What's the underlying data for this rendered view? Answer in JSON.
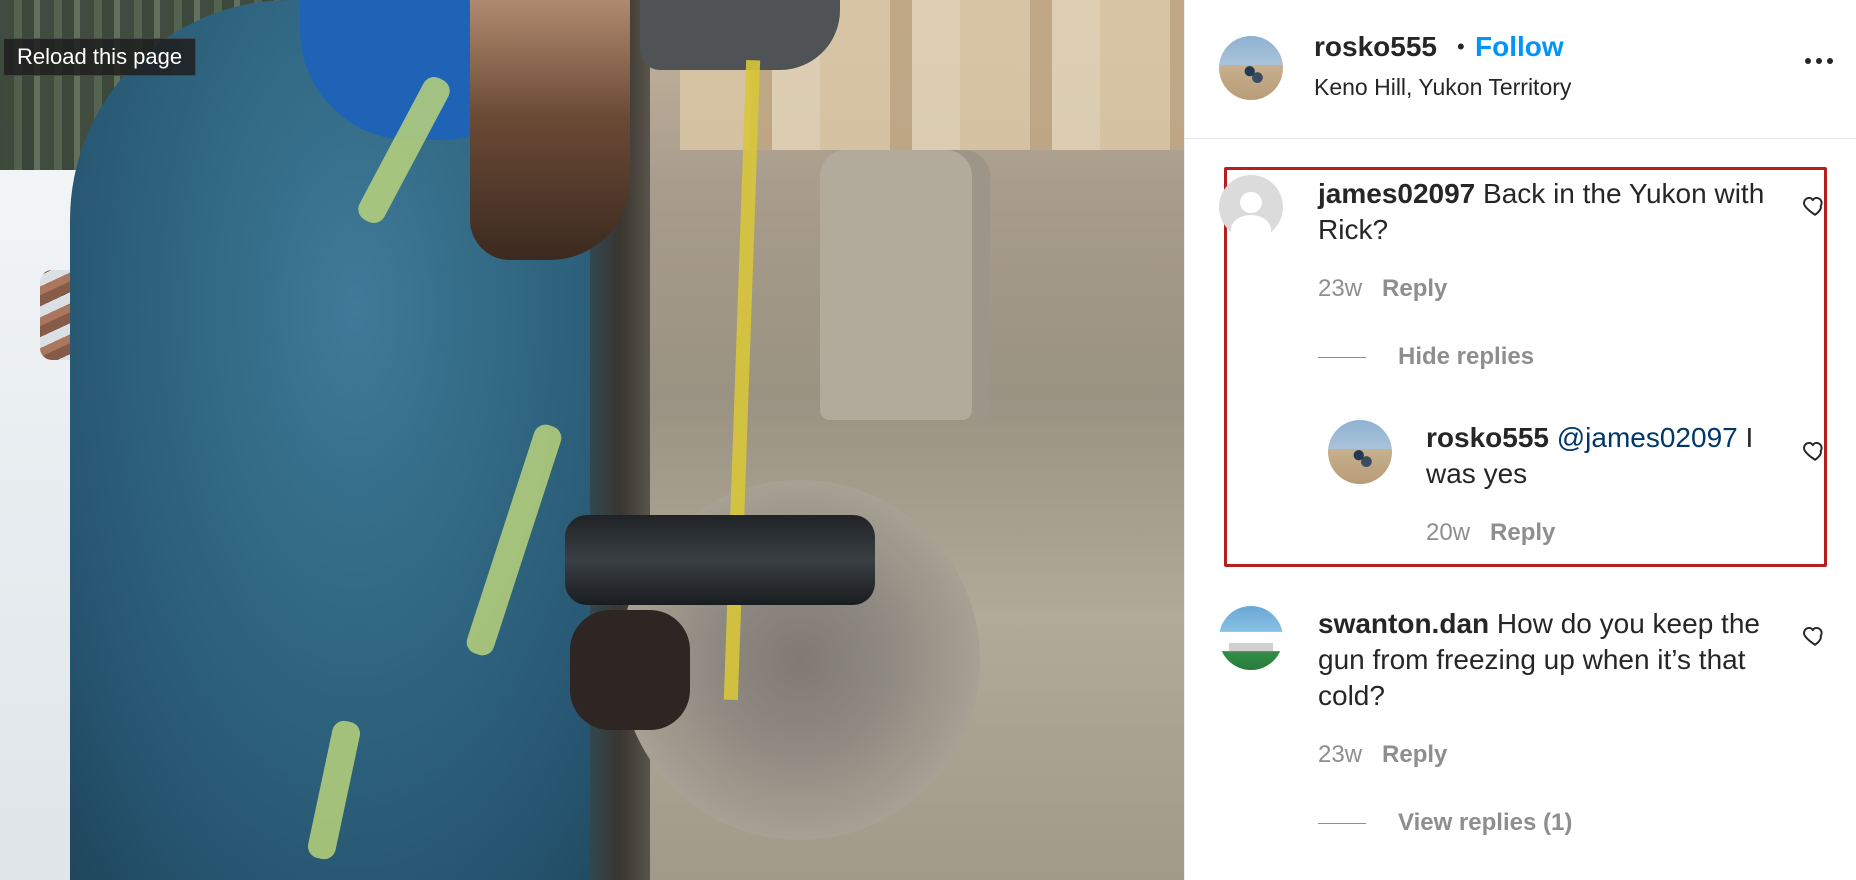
{
  "media": {
    "overlay_tooltip": "Reload this page"
  },
  "post": {
    "author": "rosko555",
    "separator": "•",
    "follow_label": "Follow",
    "location": "Keno Hill, Yukon Territory"
  },
  "comments": [
    {
      "username": "james02097",
      "text": "Back in the Yukon with Rick?",
      "time": "23w",
      "reply_label": "Reply",
      "replies_toggle": "Hide replies",
      "replies": [
        {
          "username": "rosko555",
          "mention": "@james02097",
          "text": "I was yes",
          "time": "20w",
          "reply_label": "Reply"
        }
      ]
    },
    {
      "username": "swanton.dan",
      "text": "How do you keep the gun from freezing up when it’s that cold?",
      "time": "23w",
      "reply_label": "Reply",
      "replies_toggle": "View replies (1)"
    }
  ],
  "icons": {
    "more": "more-options-icon",
    "like": "heart-icon"
  },
  "colors": {
    "follow": "#0095f6",
    "mention": "#00376b",
    "highlight_border": "#b51f1f",
    "secondary_text": "#8e8e8e"
  }
}
